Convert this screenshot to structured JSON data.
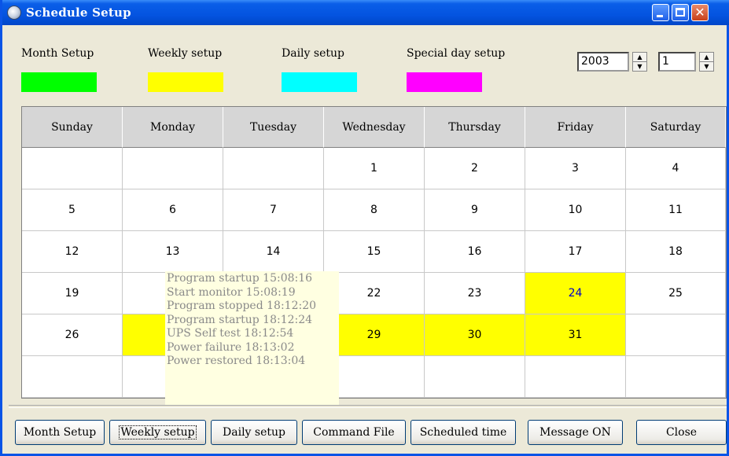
{
  "window": {
    "title": "Schedule Setup",
    "icon": "clock-icon"
  },
  "legend": [
    {
      "label": "Month Setup",
      "color": "#00ff00"
    },
    {
      "label": "Weekly setup",
      "color": "#ffff00"
    },
    {
      "label": "Daily setup",
      "color": "#00ffff"
    },
    {
      "label": "Special day setup",
      "color": "#ff00ff"
    }
  ],
  "year": "2003",
  "month": "1",
  "calendar": {
    "days": [
      "Sunday",
      "Monday",
      "Tuesday",
      "Wednesday",
      "Thursday",
      "Friday",
      "Saturday"
    ],
    "weeks": [
      [
        "",
        "",
        "",
        "1",
        "2",
        "3",
        "4"
      ],
      [
        "5",
        "6",
        "7",
        "8",
        "9",
        "10",
        "11"
      ],
      [
        "12",
        "13",
        "14",
        "15",
        "16",
        "17",
        "18"
      ],
      [
        "19",
        "",
        "",
        "22",
        "23",
        "24",
        "25"
      ],
      [
        "26",
        "",
        "",
        "29",
        "30",
        "31",
        ""
      ],
      [
        "",
        "",
        "",
        "",
        "",
        "",
        ""
      ]
    ],
    "weekly_highlight": [
      "24",
      "29",
      "30",
      "31"
    ],
    "highlight_color": "#ffff00"
  },
  "tooltip": {
    "lines": [
      "Program startup  15:08:16",
      "Start monitor  15:08:19",
      "Program stopped  18:12:20",
      "Program startup  18:12:24",
      "UPS Self test  18:12:54",
      "Power failure  18:13:02",
      "Power restored  18:13:04"
    ]
  },
  "buttons": [
    "Month Setup",
    "Weekly setup",
    "Daily setup",
    "Command File",
    "Scheduled time",
    "Message ON",
    "Close"
  ]
}
